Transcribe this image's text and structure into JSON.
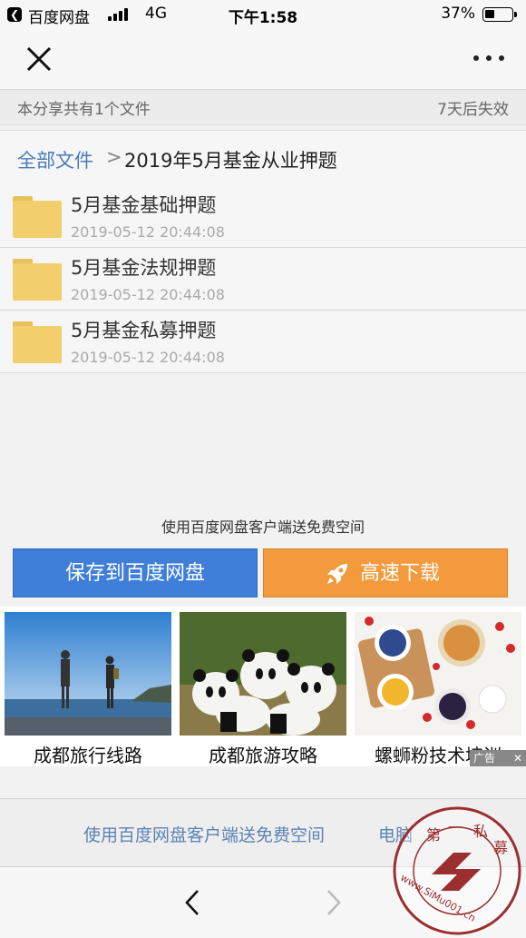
{
  "status_bar": {
    "app_name": "百度网盘",
    "network": "4G",
    "time": "下午1:58",
    "battery": "37%"
  },
  "share_info": {
    "file_count_text": "本分享共有1个文件",
    "expire_text": "7天后失效"
  },
  "breadcrumb": {
    "root": "全部文件",
    "separator": ">",
    "current": "2019年5月基金从业押题"
  },
  "files": [
    {
      "name": "5月基金基础押题",
      "date": "2019-05-12 20:44:08"
    },
    {
      "name": "5月基金法规押题",
      "date": "2019-05-12 20:44:08"
    },
    {
      "name": "5月基金私募押题",
      "date": "2019-05-12 20:44:08"
    }
  ],
  "promo": {
    "text": "使用百度网盘客户端送免费空间",
    "save_button": "保存到百度网盘",
    "download_button": "高速下载"
  },
  "ads": {
    "items": [
      {
        "caption": "成都旅行线路"
      },
      {
        "caption": "成都旅游攻略"
      },
      {
        "caption": "螺蛳粉技术培训"
      }
    ],
    "badge": "广告",
    "close": "✕"
  },
  "bottom_links": {
    "link1": "使用百度网盘客户端送免费空间",
    "link2": "电脑"
  },
  "watermark": {
    "text": "第一私募 www.SiMu001.cn"
  },
  "colors": {
    "accent_blue": "#3f7fd9",
    "accent_orange": "#f39a3c",
    "link_blue": "#5b83b5",
    "folder_yellow": "#f2cf6c"
  }
}
